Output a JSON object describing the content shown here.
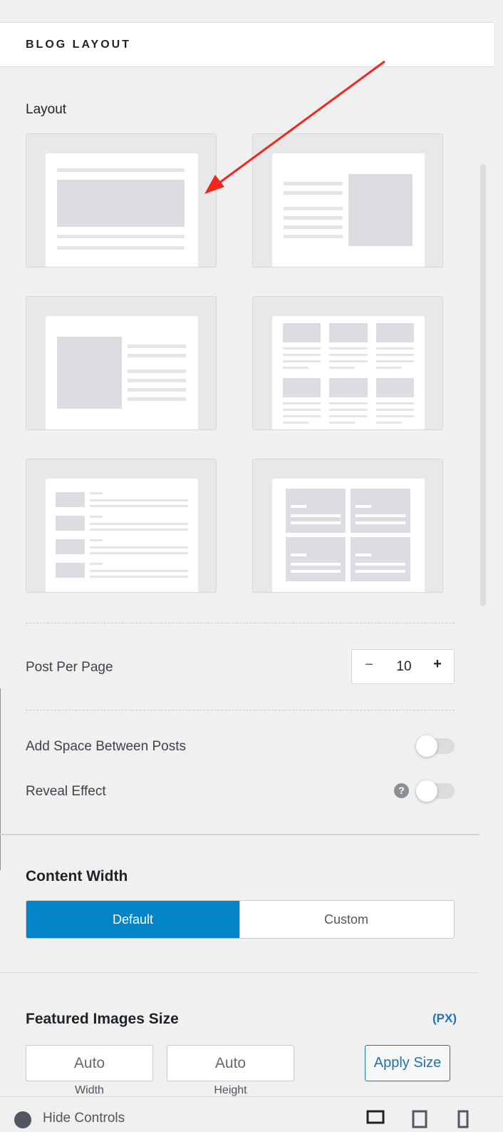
{
  "section": {
    "title": "BLOG LAYOUT"
  },
  "layout": {
    "label": "Layout",
    "options": [
      "layout-1",
      "layout-2",
      "layout-3",
      "layout-4",
      "layout-5",
      "layout-6"
    ]
  },
  "post_per_page": {
    "label": "Post Per Page",
    "value": "10",
    "minus": "−",
    "plus": "+"
  },
  "add_space": {
    "label": "Add Space Between Posts",
    "enabled": false
  },
  "reveal": {
    "label": "Reveal Effect",
    "help": "?",
    "enabled": false
  },
  "content_width": {
    "title": "Content Width",
    "default_label": "Default",
    "custom_label": "Custom",
    "selected": "Default"
  },
  "featured": {
    "title": "Featured Images Size",
    "unit": "(PX)",
    "width_value": "Auto",
    "height_value": "Auto",
    "width_caption": "Width",
    "height_caption": "Height",
    "apply_label": "Apply Size"
  },
  "footer": {
    "hide_label": "Hide Controls"
  },
  "colors": {
    "accent": "#0384c8",
    "link": "#2271b1",
    "arrow": "#f0271e"
  }
}
